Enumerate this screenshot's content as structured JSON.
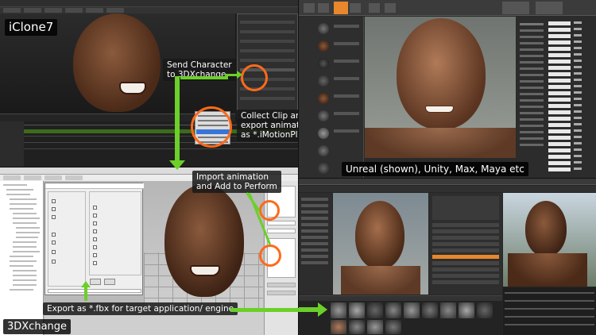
{
  "labels": {
    "iclone": "iClone7",
    "send_character": "Send Character\nto 3DXchange",
    "collect_clip": "Collect Clip and\nexport animation\nas *.iMotionPlus",
    "unreal": "Unreal (shown), Unity, Max, Maya etc",
    "import_animation": "Import animation\nand Add to Perform",
    "export_fbx": "Export as *.fbx for target application/ engine",
    "threedx": "3DXchange"
  },
  "colors": {
    "arrow": "#6ccf2a",
    "circle": "#ff6a1a",
    "ue_selected": "#e8872c"
  },
  "icons": {
    "arrow": "arrow-icon",
    "circle": "highlight-circle-icon"
  }
}
